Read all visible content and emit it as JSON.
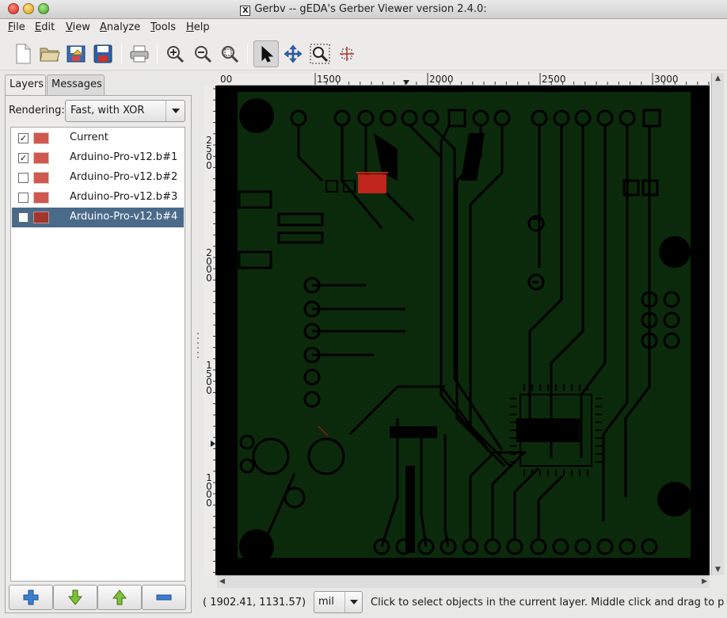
{
  "window": {
    "title": "Gerbv -- gEDA's Gerber Viewer version 2.4.0:"
  },
  "menu": [
    {
      "label": "File",
      "key": "F"
    },
    {
      "label": "Edit",
      "key": "E"
    },
    {
      "label": "View",
      "key": "V"
    },
    {
      "label": "Analyze",
      "key": "A"
    },
    {
      "label": "Tools",
      "key": "T"
    },
    {
      "label": "Help",
      "key": "H"
    }
  ],
  "toolbar": {
    "buttons": [
      "new-project",
      "open-project",
      "revert",
      "save",
      "print",
      "zoom-in",
      "zoom-out",
      "zoom-fit",
      "pointer-tool",
      "pan-tool",
      "zoom-tool",
      "measure-tool"
    ],
    "active": "pointer-tool"
  },
  "sidebar": {
    "tabs": [
      {
        "label": "Layers",
        "active": true
      },
      {
        "label": "Messages",
        "active": false
      }
    ],
    "rendering_label": "Rendering:",
    "rendering_value": "Fast, with XOR",
    "layers": [
      {
        "name": "Current",
        "checked": true,
        "color": "#d0584e"
      },
      {
        "name": "Arduino-Pro-v12.b#1",
        "checked": true,
        "color": "#d0584e"
      },
      {
        "name": "Arduino-Pro-v12.b#2",
        "checked": false,
        "color": "#d0584e"
      },
      {
        "name": "Arduino-Pro-v12.b#3",
        "checked": false,
        "color": "#d0584e"
      },
      {
        "name": "Arduino-Pro-v12.b#4",
        "checked": false,
        "color": "#a2342e",
        "selected": true
      }
    ],
    "bottom_buttons": [
      "add-layer",
      "move-layer-down",
      "move-layer-up",
      "remove-layer"
    ]
  },
  "rulers": {
    "horizontal": [
      "00",
      "1500",
      "2000",
      "2500",
      "3000"
    ],
    "vertical": [
      "2500",
      "2000",
      "1500",
      "1000"
    ]
  },
  "canvas": {
    "board_color": "#0b2a0b",
    "highlight_color": "#c0241c"
  },
  "status": {
    "coords": "( 1902.41,  1131.57)",
    "unit": "mil",
    "message": "Click to select objects in the current layer. Middle click and drag to p..."
  }
}
